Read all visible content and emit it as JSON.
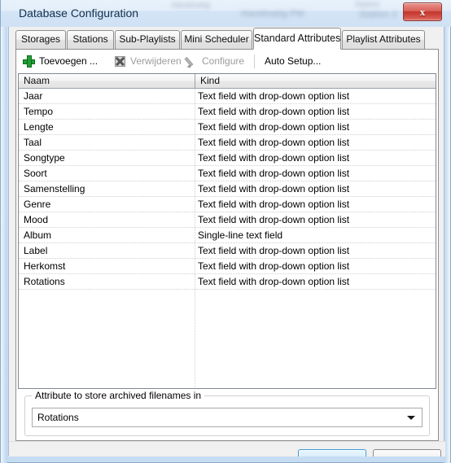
{
  "window": {
    "title": "Database Configuration",
    "close_label": "x",
    "close_icon": "close-icon"
  },
  "tabs": [
    {
      "label": "Storages",
      "active": false
    },
    {
      "label": "Stations",
      "active": false
    },
    {
      "label": "Sub-Playlists",
      "active": false
    },
    {
      "label": "Mini Scheduler",
      "active": false
    },
    {
      "label": "Standard Attributes",
      "active": true
    },
    {
      "label": "Playlist Attributes",
      "active": false
    }
  ],
  "toolbar": {
    "add_label": "Toevoegen ...",
    "add_icon": "plus-icon",
    "delete_label": "Verwijderen",
    "delete_icon": "delete-icon",
    "configure_label": "Configure",
    "configure_icon": "pencil-icon",
    "auto_setup_label": "Auto Setup..."
  },
  "grid": {
    "columns": [
      "Naam",
      "Kind"
    ],
    "rows": [
      {
        "naam": "Jaar",
        "kind": "Text field with drop-down option list"
      },
      {
        "naam": "Tempo",
        "kind": "Text field with drop-down option list"
      },
      {
        "naam": "Lengte",
        "kind": "Text field with drop-down option list"
      },
      {
        "naam": "Taal",
        "kind": "Text field with drop-down option list"
      },
      {
        "naam": "Songtype",
        "kind": "Text field with drop-down option list"
      },
      {
        "naam": "Soort",
        "kind": "Text field with drop-down option list"
      },
      {
        "naam": "Samenstelling",
        "kind": "Text field with drop-down option list"
      },
      {
        "naam": "Genre",
        "kind": "Text field with drop-down option list"
      },
      {
        "naam": "Mood",
        "kind": "Text field with drop-down option list"
      },
      {
        "naam": "Album",
        "kind": "Single-line text field"
      },
      {
        "naam": "Label",
        "kind": "Text field with drop-down option list"
      },
      {
        "naam": "Herkomst",
        "kind": "Text field with drop-down option list"
      },
      {
        "naam": "Rotations",
        "kind": "Text field with drop-down option list"
      }
    ]
  },
  "archive_group": {
    "title": "Attribute to store archived filenames in",
    "selected": "Rotations"
  },
  "colors": {
    "accent": "#3c9ad6",
    "close_red": "#c4352c",
    "add_green": "#1f9e33",
    "window_glass": "#cfe1f4"
  }
}
